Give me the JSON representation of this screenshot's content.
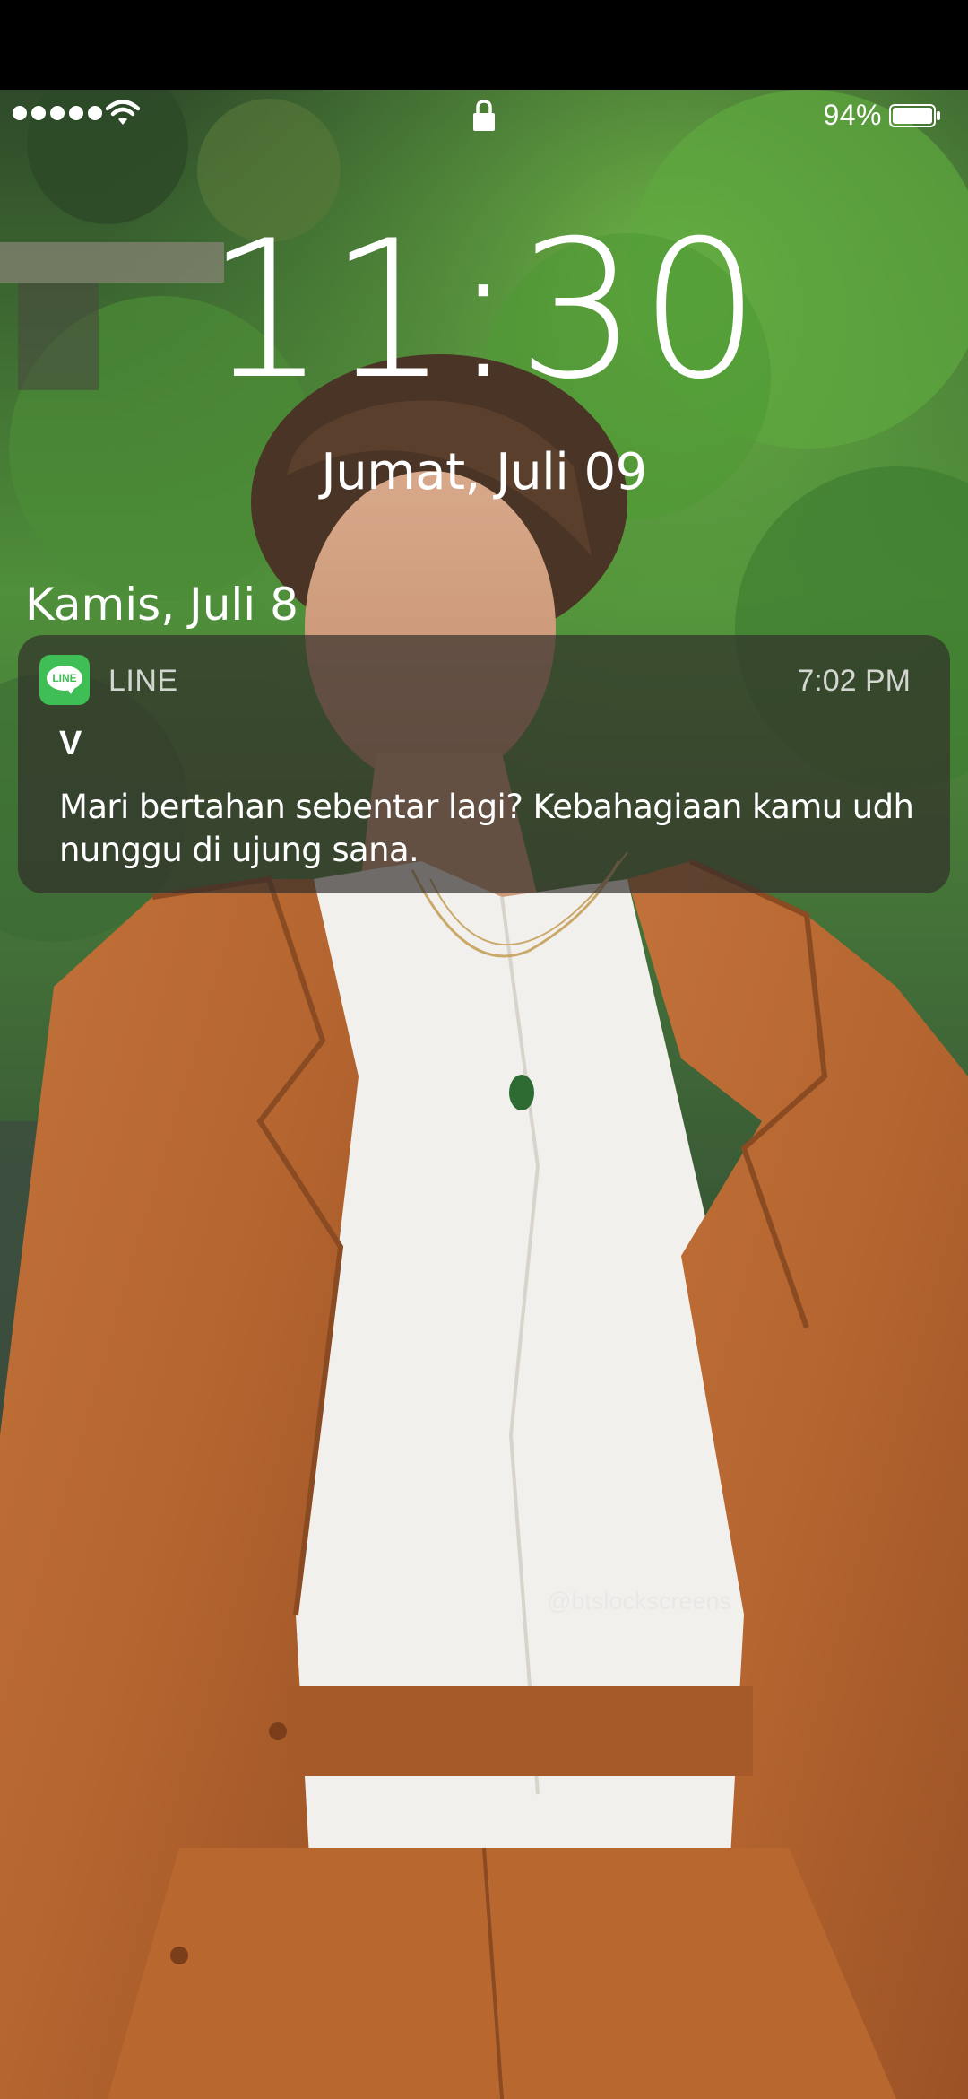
{
  "status_bar": {
    "battery_percent": "94%",
    "signal_bars": 5,
    "battery_level": 0.94
  },
  "lock_screen": {
    "time": "11:30",
    "date": "Jumat, Juli 09"
  },
  "notifications": {
    "section_header": "Kamis, Juli 8",
    "items": [
      {
        "app_name": "LINE",
        "app_icon_label": "LINE",
        "time": "7:02 PM",
        "title": "V",
        "body": "Mari bertahan sebentar lagi? Kebahagiaan kamu udh nunggu di ujung sana."
      }
    ]
  },
  "wallpaper": {
    "watermark": "@btslockscreens",
    "colors": {
      "foliage": "#4f8f3a",
      "suit": "#b5652f",
      "shirt": "#f2f0ec",
      "hair": "#4a3426"
    }
  },
  "colors": {
    "line_green": "#3fbe55",
    "notification_bg": "rgba(48,44,42,0.68)"
  }
}
